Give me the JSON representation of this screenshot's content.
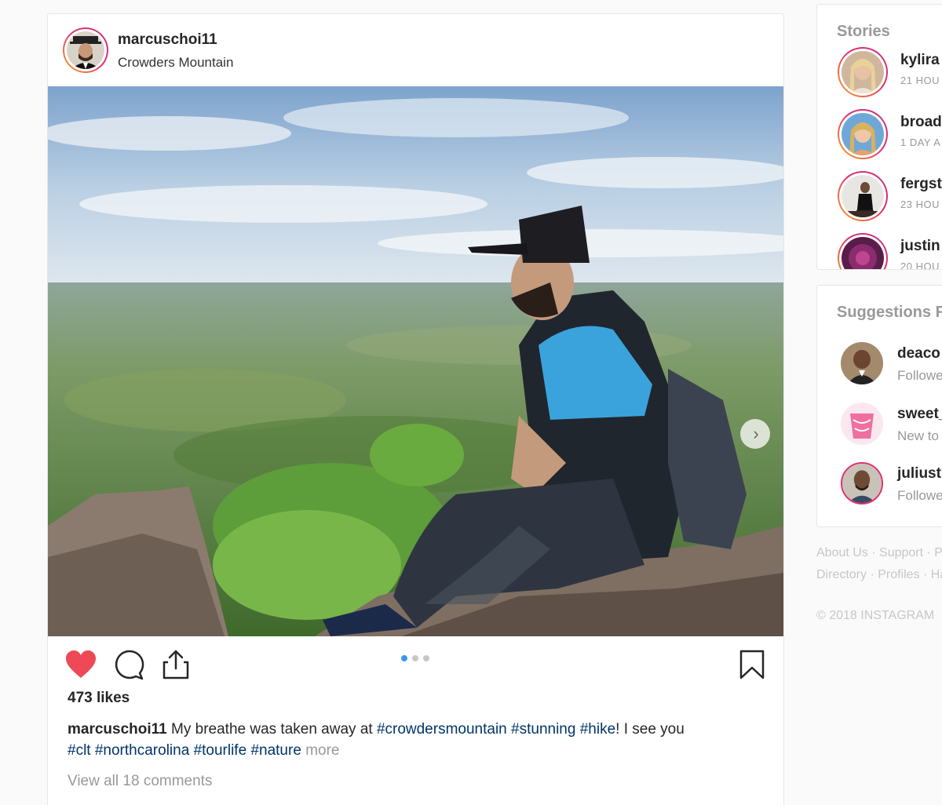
{
  "post": {
    "username": "marcuschoi11",
    "location": "Crowders Mountain",
    "likes": "473 likes",
    "caption": {
      "username": "marcuschoi11",
      "text1": " My breathe was taken away at ",
      "tag1": "#crowdersmountain",
      "tag2": "#stunning",
      "tag3": "#hike",
      "text2": "! I see you",
      "tag4": "#clt",
      "tag5": "#northcarolina",
      "tag6": "#tourlife",
      "tag7": "#nature",
      "more": "more"
    },
    "view_comments": "View all 18 comments",
    "carousel": {
      "count": 3,
      "active_index": 0
    },
    "liked": true
  },
  "sidebar": {
    "stories_title": "Stories",
    "stories": [
      {
        "name": "kylira",
        "time": "21 HOU"
      },
      {
        "name": "broad",
        "time": "1 DAY A"
      },
      {
        "name": "fergst",
        "time": "23 HOU"
      },
      {
        "name": "justin",
        "time": "20 HOU"
      }
    ],
    "suggestions_title": "Suggestions F",
    "suggestions": [
      {
        "name": "deaco",
        "sub": "Followe"
      },
      {
        "name": "sweet_",
        "sub": "New to"
      },
      {
        "name": "juliust",
        "sub": "Followe"
      }
    ],
    "footer_line1": "About Us · Support · P",
    "footer_line2": "Directory · Profiles · Ha",
    "copyright": "© 2018 INSTAGRAM"
  },
  "colors": {
    "heart": "#ed4956",
    "hashtag": "#003569",
    "dot_active": "#3897f0"
  },
  "icons": [
    "heart-icon",
    "comment-icon",
    "share-icon",
    "bookmark-icon",
    "chevron-right-icon"
  ]
}
